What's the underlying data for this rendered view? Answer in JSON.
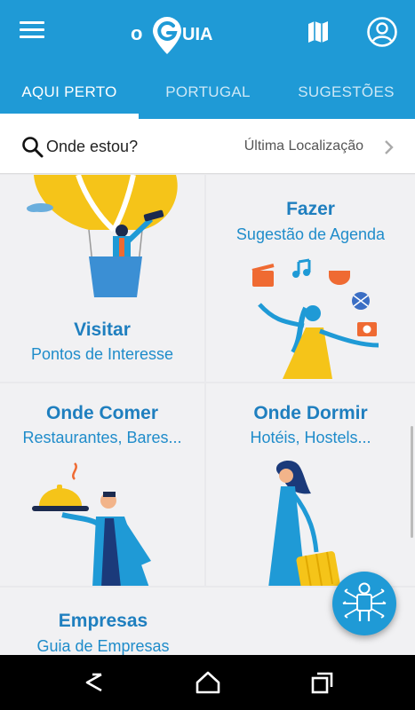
{
  "app": {
    "logo_text_left": "o",
    "logo_text_right": "UIA"
  },
  "header": {
    "menu_icon": "hamburger-menu-icon",
    "map_icon": "map-icon",
    "profile_icon": "account-circle-icon"
  },
  "tabs": [
    {
      "label": "AQUI PERTO",
      "active": true
    },
    {
      "label": "PORTUGAL",
      "active": false
    },
    {
      "label": "SUGESTÕES",
      "active": false
    }
  ],
  "location": {
    "label": "Onde estou?",
    "last_label": "Última Localização",
    "icon": "search-icon"
  },
  "cards": [
    {
      "title": "Visitar",
      "subtitle": "Pontos de Interesse"
    },
    {
      "title": "Fazer",
      "subtitle": "Sugestão de Agenda"
    },
    {
      "title": "Onde Comer",
      "subtitle": "Restaurantes, Bares..."
    },
    {
      "title": "Onde Dormir",
      "subtitle": "Hotéis, Hostels..."
    },
    {
      "title": "Empresas",
      "subtitle": "Guia de Empresas"
    }
  ],
  "colors": {
    "primary": "#1f9ad6",
    "accent_yellow": "#f5c419",
    "title_blue": "#1f7fbf",
    "orange": "#ef6a32"
  }
}
